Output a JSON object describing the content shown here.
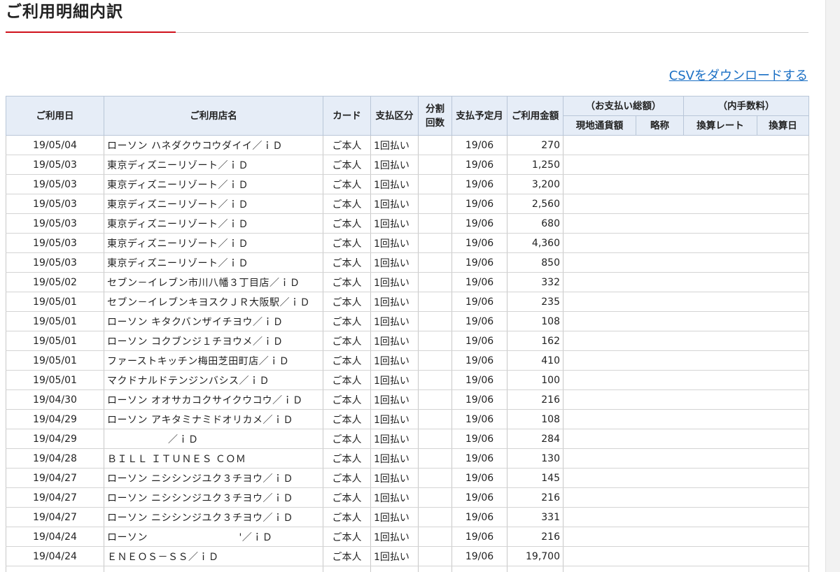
{
  "page_title": "ご利用明細内訳",
  "csv_link": "CSVをダウンロードする",
  "table": {
    "headers": {
      "date": "ご利用日",
      "shop": "ご利用店名",
      "card": "カード",
      "pay_type": "支払区分",
      "installments_line1": "分割",
      "installments_line2": "回数",
      "pay_month": "支払予定月",
      "amount": "ご利用金額",
      "total_group": "（お支払い総額）",
      "fee_group": "（内手数料）",
      "local_amount": "現地通貨額",
      "abbr": "略称",
      "rate": "換算レート",
      "conv_date": "換算日"
    },
    "rows": [
      {
        "date": "19/05/04",
        "shop": "ローソン ハネダクウコウダイイ／ｉＤ",
        "card": "ご本人",
        "pay": "1回払い",
        "month": "19/06",
        "amount": "270"
      },
      {
        "date": "19/05/03",
        "shop": "東京ディズニーリゾート／ｉＤ",
        "card": "ご本人",
        "pay": "1回払い",
        "month": "19/06",
        "amount": "1,250"
      },
      {
        "date": "19/05/03",
        "shop": "東京ディズニーリゾート／ｉＤ",
        "card": "ご本人",
        "pay": "1回払い",
        "month": "19/06",
        "amount": "3,200"
      },
      {
        "date": "19/05/03",
        "shop": "東京ディズニーリゾート／ｉＤ",
        "card": "ご本人",
        "pay": "1回払い",
        "month": "19/06",
        "amount": "2,560"
      },
      {
        "date": "19/05/03",
        "shop": "東京ディズニーリゾート／ｉＤ",
        "card": "ご本人",
        "pay": "1回払い",
        "month": "19/06",
        "amount": "680"
      },
      {
        "date": "19/05/03",
        "shop": "東京ディズニーリゾート／ｉＤ",
        "card": "ご本人",
        "pay": "1回払い",
        "month": "19/06",
        "amount": "4,360"
      },
      {
        "date": "19/05/03",
        "shop": "東京ディズニーリゾート／ｉＤ",
        "card": "ご本人",
        "pay": "1回払い",
        "month": "19/06",
        "amount": "850"
      },
      {
        "date": "19/05/02",
        "shop": "セブン－イレブン市川八幡３丁目店／ｉＤ",
        "card": "ご本人",
        "pay": "1回払い",
        "month": "19/06",
        "amount": "332"
      },
      {
        "date": "19/05/01",
        "shop": "セブン－イレブンキヨスクＪＲ大阪駅／ｉＤ",
        "card": "ご本人",
        "pay": "1回払い",
        "month": "19/06",
        "amount": "235"
      },
      {
        "date": "19/05/01",
        "shop": "ローソン キタクバンザイチヨウ／ｉＤ",
        "card": "ご本人",
        "pay": "1回払い",
        "month": "19/06",
        "amount": "108"
      },
      {
        "date": "19/05/01",
        "shop": "ローソン コクブンジ１チヨウメ／ｉＤ",
        "card": "ご本人",
        "pay": "1回払い",
        "month": "19/06",
        "amount": "162"
      },
      {
        "date": "19/05/01",
        "shop": "ファーストキッチン梅田芝田町店／ｉＤ",
        "card": "ご本人",
        "pay": "1回払い",
        "month": "19/06",
        "amount": "410"
      },
      {
        "date": "19/05/01",
        "shop": "マクドナルドテンジンバシス／ｉＤ",
        "card": "ご本人",
        "pay": "1回払い",
        "month": "19/06",
        "amount": "100"
      },
      {
        "date": "19/04/30",
        "shop": "ローソン オオサカコクサイクウコウ／ｉＤ",
        "card": "ご本人",
        "pay": "1回払い",
        "month": "19/06",
        "amount": "216"
      },
      {
        "date": "19/04/29",
        "shop": "ローソン アキタミナミドオリカメ／ｉＤ",
        "card": "ご本人",
        "pay": "1回払い",
        "month": "19/06",
        "amount": "108"
      },
      {
        "date": "19/04/29",
        "shop": "　　　　　　／ｉＤ",
        "card": "ご本人",
        "pay": "1回払い",
        "month": "19/06",
        "amount": "284"
      },
      {
        "date": "19/04/28",
        "shop": "ＢＩＬＬ ＩＴＵＮＥＳ ＣＯＭ",
        "card": "ご本人",
        "pay": "1回払い",
        "month": "19/06",
        "amount": "130"
      },
      {
        "date": "19/04/27",
        "shop": "ローソン ニシシンジユク３チヨウ／ｉＤ",
        "card": "ご本人",
        "pay": "1回払い",
        "month": "19/06",
        "amount": "145"
      },
      {
        "date": "19/04/27",
        "shop": "ローソン ニシシンジユク３チヨウ／ｉＤ",
        "card": "ご本人",
        "pay": "1回払い",
        "month": "19/06",
        "amount": "216"
      },
      {
        "date": "19/04/27",
        "shop": "ローソン ニシシンジユク３チヨウ／ｉＤ",
        "card": "ご本人",
        "pay": "1回払い",
        "month": "19/06",
        "amount": "331"
      },
      {
        "date": "19/04/24",
        "shop": "ローソン　　　　　　　　　'／ｉＤ",
        "card": "ご本人",
        "pay": "1回払い",
        "month": "19/06",
        "amount": "216"
      },
      {
        "date": "19/04/24",
        "shop": "ＥＮＥＯＳ－ＳＳ／ｉＤ",
        "card": "ご本人",
        "pay": "1回払い",
        "month": "19/06",
        "amount": "19,700"
      },
      {
        "date": "",
        "shop": "",
        "card": "",
        "pay": "",
        "month": "",
        "amount": ""
      }
    ]
  }
}
